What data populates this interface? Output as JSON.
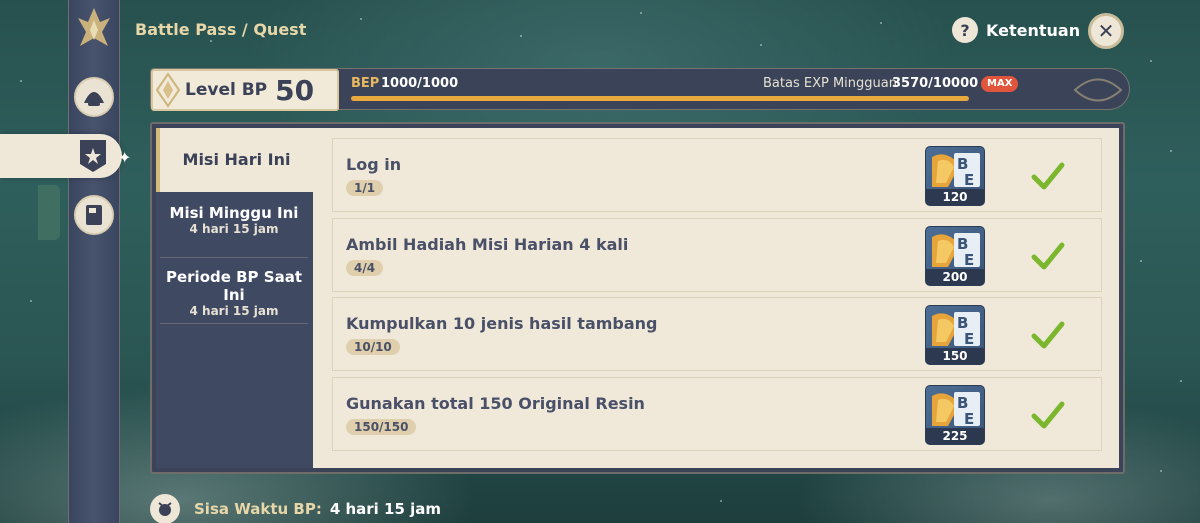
{
  "header": {
    "breadcrumb": "Battle Pass / Quest",
    "rules_label": "Ketentuan",
    "rules_icon": "question-icon",
    "close_icon": "close-icon"
  },
  "level": {
    "label": "Level BP",
    "value": "50"
  },
  "bep": {
    "label": "BEP",
    "value": "1000/1000",
    "progress_percent": 100
  },
  "weekly_exp": {
    "label": "Batas EXP Mingguan",
    "value": "3570/10000",
    "badge": "MAX"
  },
  "tabs": [
    {
      "title": "Misi Hari Ini",
      "subtitle": ""
    },
    {
      "title": "Misi Minggu Ini",
      "subtitle": "4 hari 15 jam"
    },
    {
      "title": "Periode BP Saat Ini",
      "subtitle": "4 hari 15 jam"
    }
  ],
  "quests": [
    {
      "title": "Log in",
      "progress": "1/1",
      "reward": "120",
      "completed": true
    },
    {
      "title": "Ambil Hadiah Misi Harian 4 kali",
      "progress": "4/4",
      "reward": "200",
      "completed": true
    },
    {
      "title": "Kumpulkan 10 jenis hasil tambang",
      "progress": "10/10",
      "reward": "150",
      "completed": true
    },
    {
      "title": "Gunakan total 150 Original Resin",
      "progress": "150/150",
      "reward": "225",
      "completed": true
    }
  ],
  "footer": {
    "label": "Sisa Waktu BP:",
    "value": "4 hari 15 jam"
  },
  "colors": {
    "accent_gold": "#e8a93f",
    "panel_navy": "#3a4358",
    "parchment": "#efe8d8",
    "check_green": "#7ab72f",
    "max_badge": "#e0553c"
  }
}
